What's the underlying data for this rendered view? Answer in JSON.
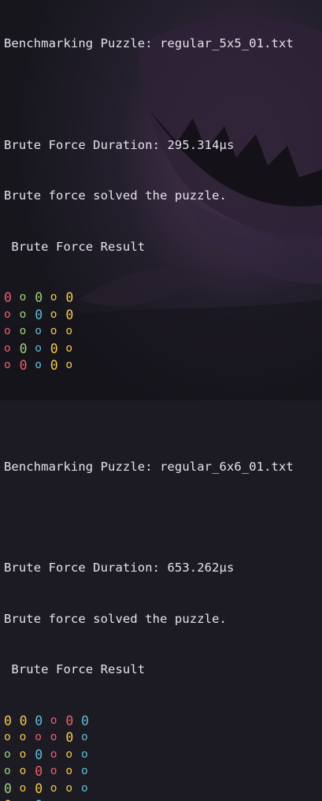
{
  "colors": {
    "background": "#1c1b24",
    "text": "#e6e3ec",
    "red": "#ea5f6c",
    "green": "#9fcf7a",
    "blue": "#63b8d8",
    "yellow": "#f2c54f"
  },
  "output": {
    "block1": {
      "benchmark": "Benchmarking Puzzle: regular_5x5_01.txt",
      "duration": "Brute Force Duration: 295.314µs",
      "solved": "Brute force solved the puzzle.",
      "result_header": " Brute Force Result",
      "grid": [
        [
          {
            "c": "red",
            "t": "0"
          },
          {
            "c": "green",
            "t": "o"
          },
          {
            "c": "green",
            "t": "0"
          },
          {
            "c": "yellow",
            "t": "o"
          },
          {
            "c": "yellow",
            "t": "0"
          }
        ],
        [
          {
            "c": "red",
            "t": "o"
          },
          {
            "c": "green",
            "t": "o"
          },
          {
            "c": "blue",
            "t": "0"
          },
          {
            "c": "yellow",
            "t": "o"
          },
          {
            "c": "yellow",
            "t": "0"
          }
        ],
        [
          {
            "c": "red",
            "t": "o"
          },
          {
            "c": "green",
            "t": "o"
          },
          {
            "c": "blue",
            "t": "o"
          },
          {
            "c": "yellow",
            "t": "o"
          },
          {
            "c": "yellow",
            "t": "o"
          }
        ],
        [
          {
            "c": "red",
            "t": "o"
          },
          {
            "c": "green",
            "t": "0"
          },
          {
            "c": "blue",
            "t": "o"
          },
          {
            "c": "yellow",
            "t": "0"
          },
          {
            "c": "yellow",
            "t": "o"
          }
        ],
        [
          {
            "c": "red",
            "t": "o"
          },
          {
            "c": "red",
            "t": "0"
          },
          {
            "c": "blue",
            "t": "o"
          },
          {
            "c": "yellow",
            "t": "0"
          },
          {
            "c": "yellow",
            "t": "o"
          }
        ]
      ]
    },
    "block2": {
      "benchmark": "Benchmarking Puzzle: regular_6x6_01.txt",
      "duration": "Brute Force Duration: 653.262µs",
      "solved": "Brute force solved the puzzle.",
      "result_header": " Brute Force Result",
      "grid": [
        [
          {
            "c": "yellow",
            "t": "0"
          },
          {
            "c": "yellow",
            "t": "0"
          },
          {
            "c": "blue",
            "t": "0"
          },
          {
            "c": "red",
            "t": "o"
          },
          {
            "c": "red",
            "t": "0"
          },
          {
            "c": "blue",
            "t": "0"
          }
        ],
        [
          {
            "c": "yellow",
            "t": "o"
          },
          {
            "c": "yellow",
            "t": "o"
          },
          {
            "c": "red",
            "t": "o"
          },
          {
            "c": "red",
            "t": "o"
          },
          {
            "c": "yellow",
            "t": "0"
          },
          {
            "c": "blue",
            "t": "o"
          }
        ],
        [
          {
            "c": "green",
            "t": "o"
          },
          {
            "c": "yellow",
            "t": "o"
          },
          {
            "c": "blue",
            "t": "0"
          },
          {
            "c": "red",
            "t": "o"
          },
          {
            "c": "yellow",
            "t": "o"
          },
          {
            "c": "blue",
            "t": "o"
          }
        ],
        [
          {
            "c": "green",
            "t": "o"
          },
          {
            "c": "yellow",
            "t": "o"
          },
          {
            "c": "red",
            "t": "0"
          },
          {
            "c": "red",
            "t": "o"
          },
          {
            "c": "yellow",
            "t": "o"
          },
          {
            "c": "blue",
            "t": "o"
          }
        ],
        [
          {
            "c": "green",
            "t": "0"
          },
          {
            "c": "yellow",
            "t": "o"
          },
          {
            "c": "yellow",
            "t": "0"
          },
          {
            "c": "yellow",
            "t": "o"
          },
          {
            "c": "yellow",
            "t": "o"
          },
          {
            "c": "blue",
            "t": "o"
          }
        ],
        [
          {
            "c": "yellow",
            "t": "0"
          },
          {
            "c": "yellow",
            "t": "o"
          },
          {
            "c": "blue",
            "t": "0"
          },
          {
            "c": "blue",
            "t": "o"
          },
          {
            "c": "blue",
            "t": "o"
          },
          {
            "c": "blue",
            "t": "o"
          }
        ]
      ]
    }
  }
}
